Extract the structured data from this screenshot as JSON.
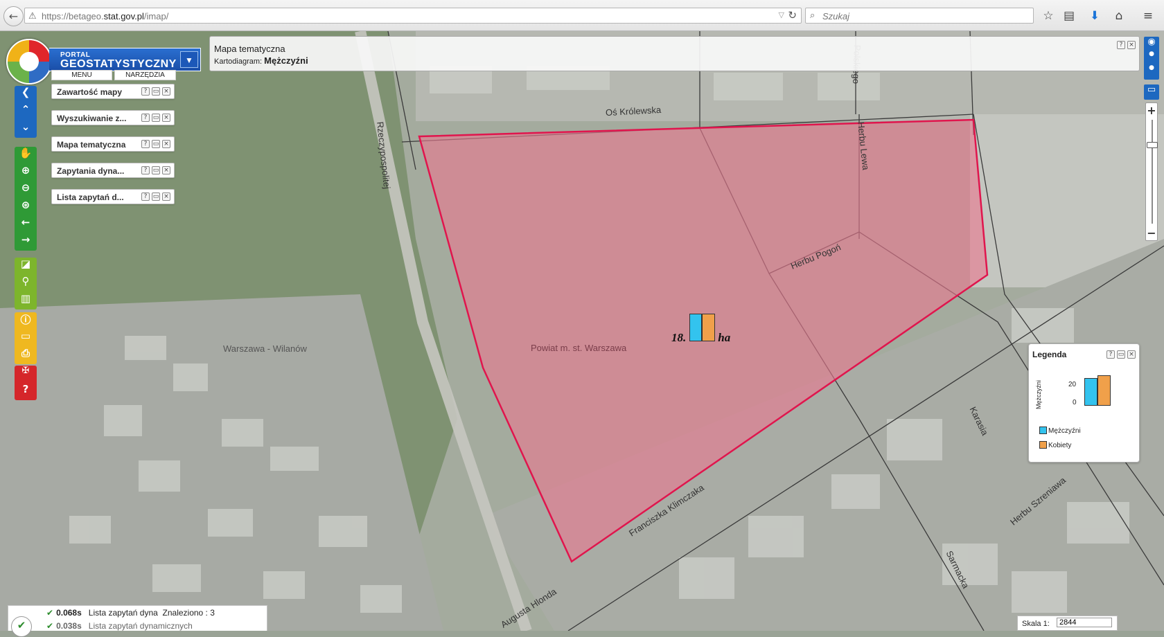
{
  "browser": {
    "url_prefix": "https://betageo.",
    "url_domain": "stat.gov.pl",
    "url_path": "/imap/",
    "search_placeholder": "Szukaj"
  },
  "logo": {
    "line1": "PORTAL",
    "line2": "GEOSTATYSTYCZNY"
  },
  "top_menu": {
    "menu": "MENU",
    "tools": "NARZĘDZIA"
  },
  "panels": [
    {
      "title": "Zawartość mapy"
    },
    {
      "title": "Wyszukiwanie z..."
    },
    {
      "title": "Mapa tematyczna"
    },
    {
      "title": "Zapytania dyna..."
    },
    {
      "title": "Lista zapytań d..."
    }
  ],
  "panel_buttons": {
    "help": "?",
    "min": "▭",
    "close": "×"
  },
  "thematic": {
    "title": "Mapa tematyczna",
    "label": "Kartodiagram:",
    "value": "Mężczyźni"
  },
  "map_labels": {
    "street_krolewska": "Oś Królewska",
    "street_rzeczypospolitej": "Rzeczypospolitej",
    "street_herbu_lewa": "Herbu Lewa",
    "street_poslka": "Polskiego",
    "street_herbu_pogon": "Herbu Pogoń",
    "street_klimczaka": "Franciszka Klimczaka",
    "street_hlonda": "Augusta Hlonda",
    "street_karasia": "Karasia",
    "street_sarmacka": "Sarmacka",
    "street_szreniawa": "Herbu Szreniawa",
    "area_wilanow": "Warszawa - Wilanów",
    "area_powiat": "Powiat m. st. Warszawa",
    "symbol_label_left": "18.",
    "symbol_label_right": "ha"
  },
  "legend": {
    "title": "Legenda",
    "axis_name": "Mężczyźni",
    "tick_high": "20",
    "tick_low": "0",
    "items": [
      {
        "label": "Mężczyźni",
        "color": "#33c3ee"
      },
      {
        "label": "Kobiety",
        "color": "#f0a04a"
      }
    ]
  },
  "status": {
    "rows": [
      {
        "time": "0.068s",
        "text": "Lista zapytań dyna",
        "found": "Znaleziono : 3"
      },
      {
        "time": "0.038s",
        "text": "Lista zapytań dynamicznych",
        "found": ""
      }
    ]
  },
  "scale": {
    "label": "Skala 1:",
    "value": "2844"
  },
  "colors": {
    "area_fill": "#e8798f",
    "area_stroke": "#e0154d",
    "accent": "#1d68c0"
  }
}
